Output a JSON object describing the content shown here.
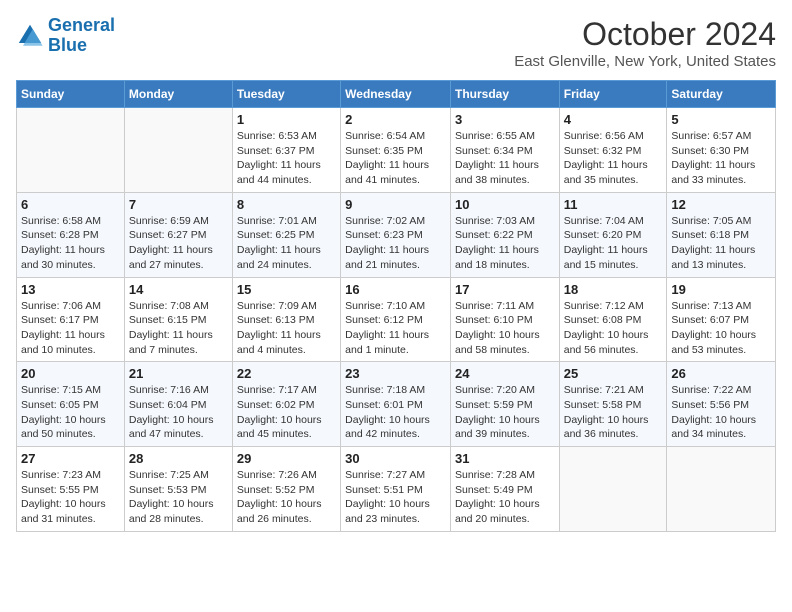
{
  "logo": {
    "line1": "General",
    "line2": "Blue"
  },
  "title": "October 2024",
  "subtitle": "East Glenville, New York, United States",
  "days_header": [
    "Sunday",
    "Monday",
    "Tuesday",
    "Wednesday",
    "Thursday",
    "Friday",
    "Saturday"
  ],
  "weeks": [
    [
      {
        "day": "",
        "info": ""
      },
      {
        "day": "",
        "info": ""
      },
      {
        "day": "1",
        "info": "Sunrise: 6:53 AM\nSunset: 6:37 PM\nDaylight: 11 hours and 44 minutes."
      },
      {
        "day": "2",
        "info": "Sunrise: 6:54 AM\nSunset: 6:35 PM\nDaylight: 11 hours and 41 minutes."
      },
      {
        "day": "3",
        "info": "Sunrise: 6:55 AM\nSunset: 6:34 PM\nDaylight: 11 hours and 38 minutes."
      },
      {
        "day": "4",
        "info": "Sunrise: 6:56 AM\nSunset: 6:32 PM\nDaylight: 11 hours and 35 minutes."
      },
      {
        "day": "5",
        "info": "Sunrise: 6:57 AM\nSunset: 6:30 PM\nDaylight: 11 hours and 33 minutes."
      }
    ],
    [
      {
        "day": "6",
        "info": "Sunrise: 6:58 AM\nSunset: 6:28 PM\nDaylight: 11 hours and 30 minutes."
      },
      {
        "day": "7",
        "info": "Sunrise: 6:59 AM\nSunset: 6:27 PM\nDaylight: 11 hours and 27 minutes."
      },
      {
        "day": "8",
        "info": "Sunrise: 7:01 AM\nSunset: 6:25 PM\nDaylight: 11 hours and 24 minutes."
      },
      {
        "day": "9",
        "info": "Sunrise: 7:02 AM\nSunset: 6:23 PM\nDaylight: 11 hours and 21 minutes."
      },
      {
        "day": "10",
        "info": "Sunrise: 7:03 AM\nSunset: 6:22 PM\nDaylight: 11 hours and 18 minutes."
      },
      {
        "day": "11",
        "info": "Sunrise: 7:04 AM\nSunset: 6:20 PM\nDaylight: 11 hours and 15 minutes."
      },
      {
        "day": "12",
        "info": "Sunrise: 7:05 AM\nSunset: 6:18 PM\nDaylight: 11 hours and 13 minutes."
      }
    ],
    [
      {
        "day": "13",
        "info": "Sunrise: 7:06 AM\nSunset: 6:17 PM\nDaylight: 11 hours and 10 minutes."
      },
      {
        "day": "14",
        "info": "Sunrise: 7:08 AM\nSunset: 6:15 PM\nDaylight: 11 hours and 7 minutes."
      },
      {
        "day": "15",
        "info": "Sunrise: 7:09 AM\nSunset: 6:13 PM\nDaylight: 11 hours and 4 minutes."
      },
      {
        "day": "16",
        "info": "Sunrise: 7:10 AM\nSunset: 6:12 PM\nDaylight: 11 hours and 1 minute."
      },
      {
        "day": "17",
        "info": "Sunrise: 7:11 AM\nSunset: 6:10 PM\nDaylight: 10 hours and 58 minutes."
      },
      {
        "day": "18",
        "info": "Sunrise: 7:12 AM\nSunset: 6:08 PM\nDaylight: 10 hours and 56 minutes."
      },
      {
        "day": "19",
        "info": "Sunrise: 7:13 AM\nSunset: 6:07 PM\nDaylight: 10 hours and 53 minutes."
      }
    ],
    [
      {
        "day": "20",
        "info": "Sunrise: 7:15 AM\nSunset: 6:05 PM\nDaylight: 10 hours and 50 minutes."
      },
      {
        "day": "21",
        "info": "Sunrise: 7:16 AM\nSunset: 6:04 PM\nDaylight: 10 hours and 47 minutes."
      },
      {
        "day": "22",
        "info": "Sunrise: 7:17 AM\nSunset: 6:02 PM\nDaylight: 10 hours and 45 minutes."
      },
      {
        "day": "23",
        "info": "Sunrise: 7:18 AM\nSunset: 6:01 PM\nDaylight: 10 hours and 42 minutes."
      },
      {
        "day": "24",
        "info": "Sunrise: 7:20 AM\nSunset: 5:59 PM\nDaylight: 10 hours and 39 minutes."
      },
      {
        "day": "25",
        "info": "Sunrise: 7:21 AM\nSunset: 5:58 PM\nDaylight: 10 hours and 36 minutes."
      },
      {
        "day": "26",
        "info": "Sunrise: 7:22 AM\nSunset: 5:56 PM\nDaylight: 10 hours and 34 minutes."
      }
    ],
    [
      {
        "day": "27",
        "info": "Sunrise: 7:23 AM\nSunset: 5:55 PM\nDaylight: 10 hours and 31 minutes."
      },
      {
        "day": "28",
        "info": "Sunrise: 7:25 AM\nSunset: 5:53 PM\nDaylight: 10 hours and 28 minutes."
      },
      {
        "day": "29",
        "info": "Sunrise: 7:26 AM\nSunset: 5:52 PM\nDaylight: 10 hours and 26 minutes."
      },
      {
        "day": "30",
        "info": "Sunrise: 7:27 AM\nSunset: 5:51 PM\nDaylight: 10 hours and 23 minutes."
      },
      {
        "day": "31",
        "info": "Sunrise: 7:28 AM\nSunset: 5:49 PM\nDaylight: 10 hours and 20 minutes."
      },
      {
        "day": "",
        "info": ""
      },
      {
        "day": "",
        "info": ""
      }
    ]
  ]
}
